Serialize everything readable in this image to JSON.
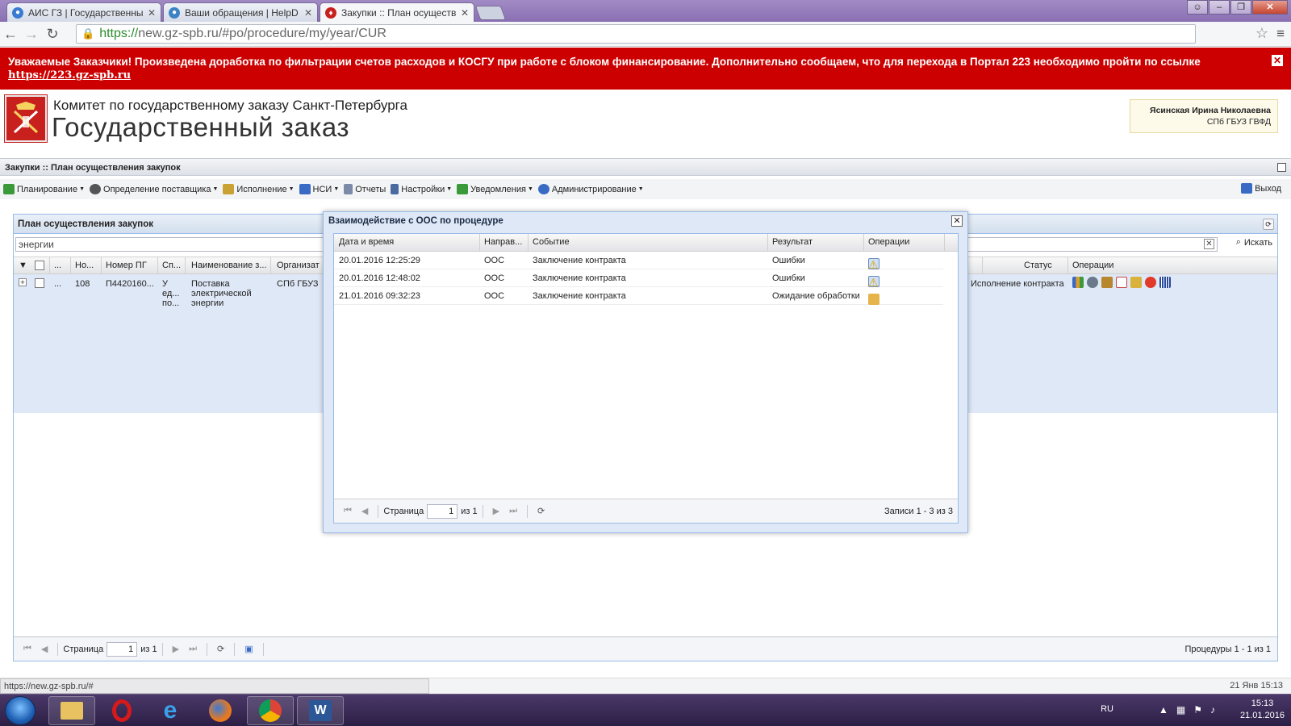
{
  "browser": {
    "tabs": [
      {
        "title": "АИС ГЗ | Государственны",
        "active": false,
        "favicon_color": "#3a7ad1"
      },
      {
        "title": "Ваши обращения | HelpD",
        "active": false,
        "favicon_color": "#3b83c4"
      },
      {
        "title": "Закупки :: План осуществ",
        "active": true,
        "favicon_color": "#c8201c"
      }
    ],
    "url_https": "https://",
    "url_rest": "new.gz-spb.ru/#po/procedure/my/year/CUR"
  },
  "banner": {
    "text": "Уважаемые Заказчики! Произведена доработка по фильтрации счетов расходов и КОСГУ при работе с блоком финансирование. Дополнительно сообщаем, что для перехода в Портал 223 необходимо пройти по ссылке",
    "link": "https://223.gz-spb.ru",
    "close": "✕",
    "color": "#cc0000"
  },
  "header": {
    "org": "Комитет по государственному заказу Санкт-Петербурга",
    "site": "Государственный заказ",
    "user_name": "Ясинская Ирина Николаевна",
    "user_org": "СПб ГБУЗ ГВФД"
  },
  "breadcrumb": "Закупки :: План осуществления закупок",
  "menu": {
    "items": [
      {
        "label": "Планирование",
        "icon_color": "#3a9a3a",
        "caret": true
      },
      {
        "label": "Определение поставщика",
        "icon_color": "#555555",
        "caret": true
      },
      {
        "label": "Исполнение",
        "icon_color": "#c9a233",
        "caret": true
      },
      {
        "label": "НСИ",
        "icon_color": "#3a6bc4",
        "caret": true
      },
      {
        "label": "Отчеты",
        "icon_color": "#7a8aa8",
        "caret": false
      },
      {
        "label": "Настройки",
        "icon_color": "#4a6aa0",
        "caret": true
      },
      {
        "label": "Уведомления",
        "icon_color": "#3a9a3a",
        "caret": true
      },
      {
        "label": "Администрирование",
        "icon_color": "#3a6bc4",
        "caret": true
      }
    ],
    "exit": "Выход"
  },
  "panel": {
    "title": "План осуществления закупок",
    "search_value": "энергии",
    "search_button": "Искать",
    "columns": [
      "...",
      "Но...",
      "Номер ПГ",
      "Сп...",
      "Наименование з...",
      "Организат",
      "Статус",
      "Операции"
    ],
    "row": {
      "more": "...",
      "num": "108",
      "pg": "П4420160...",
      "sp": "У\nед...\nпо...",
      "name": "Поставка\nэлектрической\nэнергии",
      "org": "СПб ГБУЗ",
      "status": "Исполнение контракта"
    },
    "pager": {
      "page_label": "Страница",
      "page": "1",
      "of": "из 1",
      "summary": "Процедуры 1 - 1 из 1"
    }
  },
  "modal": {
    "title": "Взаимодействие с ООС по процедуре",
    "columns": [
      "Дата и время",
      "Направ...",
      "Событие",
      "Результат",
      "Операции"
    ],
    "rows": [
      {
        "datetime": "20.01.2016 12:25:29",
        "direction": "ООС",
        "event": "Заключение контракта",
        "result": "Ошибки"
      },
      {
        "datetime": "20.01.2016 12:48:02",
        "direction": "ООС",
        "event": "Заключение контракта",
        "result": "Ошибки"
      },
      {
        "datetime": "21.01.2016 09:32:23",
        "direction": "ООС",
        "event": "Заключение контракта",
        "result": "Ожидание обработки"
      }
    ],
    "pager": {
      "page_label": "Страница",
      "page": "1",
      "of": "из 1",
      "summary": "Записи 1 - 3 из 3"
    }
  },
  "status": {
    "hover_url": "https://new.gz-spb.ru/#",
    "datetime": "21 Янв 15:13"
  },
  "taskbar": {
    "lang": "RU",
    "time": "15:13",
    "date": "21.01.2016"
  }
}
